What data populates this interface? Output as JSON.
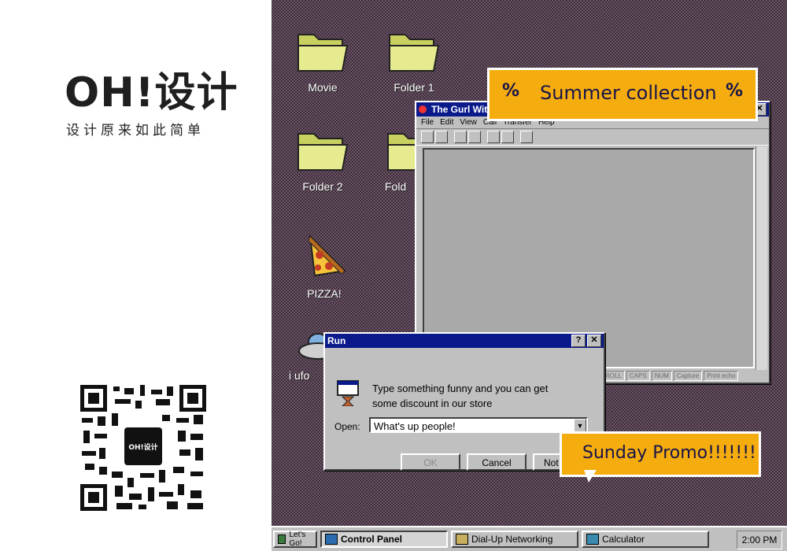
{
  "brand": {
    "logo": "OH!设计",
    "tagline": "设计原来如此简单",
    "qr_center": "OH!设计"
  },
  "desktop": {
    "icons": [
      {
        "label": "Movie",
        "icon": "folder-icon"
      },
      {
        "label": "Folder 1",
        "icon": "folder-icon"
      },
      {
        "label": "Folder 2",
        "icon": "folder-icon"
      },
      {
        "label": "Fold",
        "icon": "folder-icon"
      },
      {
        "label": "PIZZA!",
        "icon": "pizza-icon"
      },
      {
        "label": "i ufo",
        "icon": "ufo-icon"
      }
    ]
  },
  "chat_window": {
    "title": "The Gurl With H",
    "menu": [
      "File",
      "Edit",
      "View",
      "Call",
      "Transfer",
      "Help"
    ],
    "status": [
      "ROLL",
      "CAPS",
      "NUM",
      "Capture",
      "Print echo"
    ]
  },
  "run_dialog": {
    "title": "Run",
    "message_line1": "Type something funny and you can get",
    "message_line2": "some discount in our store",
    "open_label": "Open:",
    "open_value": "What's  up people!",
    "ok": "OK",
    "cancel": "Cancel",
    "not": "Not"
  },
  "promos": {
    "summer": "Summer collection",
    "summer_symbol": "%",
    "sunday": "Sunday Promo!!!!!!!"
  },
  "taskbar": {
    "start": "Let's Go!",
    "tasks": [
      "Control Panel",
      "Dial-Up Networking",
      "Calculator"
    ],
    "clock": "2:00 PM"
  },
  "colors": {
    "accent": "#f5ac0e",
    "title_bar": "#0a1a8a"
  }
}
